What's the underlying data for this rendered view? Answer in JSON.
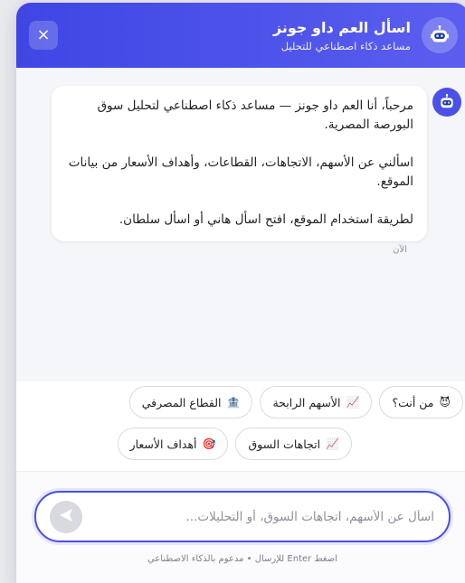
{
  "header": {
    "title": "اسأل العم داو جونز",
    "subtitle": "مساعد ذكاء اصطناعي للتحليل",
    "close_symbol": "×",
    "icons": {
      "avatar": "robot-icon",
      "close": "close-icon"
    }
  },
  "message": {
    "lines": [
      "مرحباً، أنا العم داو جونز — مساعد ذكاء اصطناعي لتحليل سوق البورصة المصرية.",
      "اسألني عن الأسهم، الاتجاهات، القطاعات، وأهداف الأسعار من بيانات الموقع.",
      "لطريقة استخدام الموقع، افتح اسأل هاني أو اسأل سلطان."
    ],
    "time": "الآن",
    "avatar_icon": "robot-icon"
  },
  "suggestions": {
    "row1": [
      {
        "icon": "😈",
        "icon_name": "devil-face-icon",
        "label": "من أنت؟"
      },
      {
        "icon": "📈",
        "icon_name": "chart-up-icon",
        "label": "الأسهم الرابحة"
      },
      {
        "icon": "🏦",
        "icon_name": "bank-icon",
        "label": "القطاع المصرفي"
      }
    ],
    "row2": [
      {
        "icon": "📈",
        "icon_name": "chart-up-icon",
        "label": "اتجاهات السوق"
      },
      {
        "icon": "🎯",
        "icon_name": "target-icon",
        "label": "أهداف الأسعار"
      }
    ]
  },
  "input": {
    "placeholder": "اسأل عن الأسهم، اتجاهات السوق، أو التحليلات...",
    "value": "",
    "send_icon": "send-arrow-icon"
  },
  "footer": {
    "hint": "اضغط Enter للإرسال • مدعوم بالذكاء الاصطناعي"
  },
  "colors": {
    "accent": "#4a4fe3",
    "header_gradient_start": "#3f46e4",
    "header_gradient_end": "#5b5ff0",
    "chat_background": "#f5f6fa"
  }
}
